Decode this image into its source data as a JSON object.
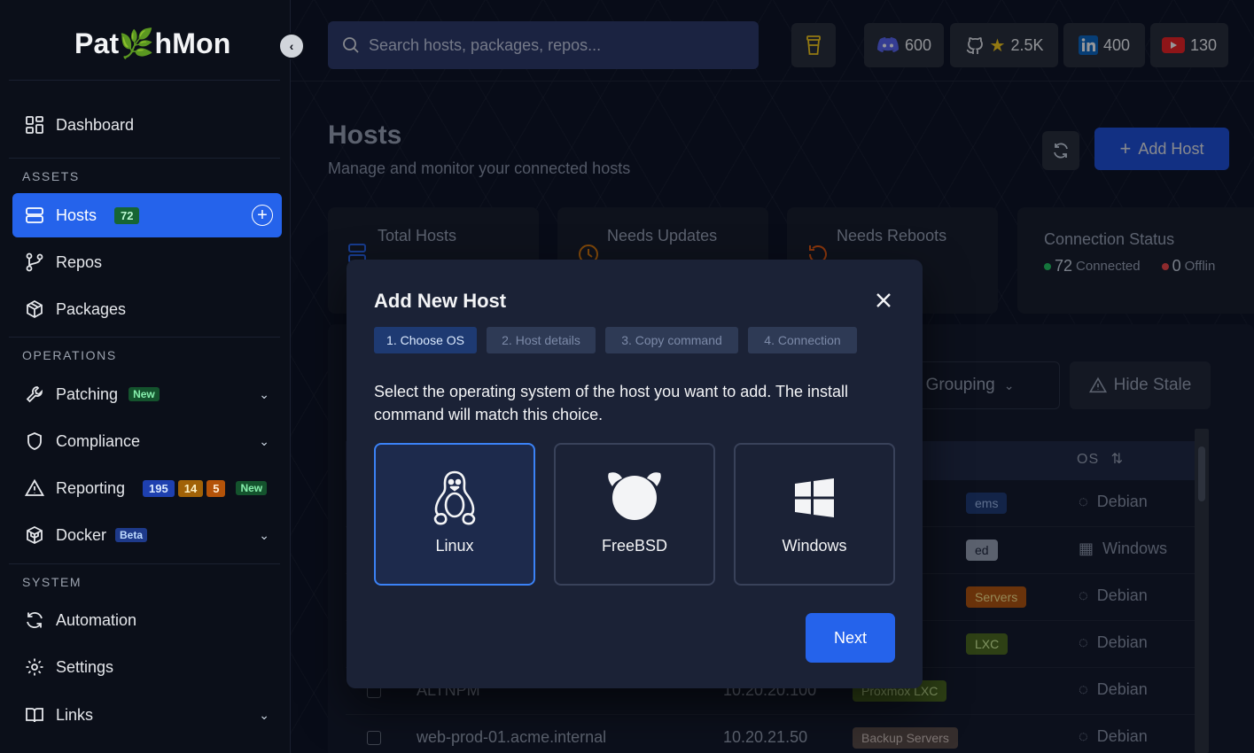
{
  "brand": {
    "logo_pre": "Pat",
    "logo_post": "hMon"
  },
  "sidebar": {
    "sections": {
      "assets": "ASSETS",
      "operations": "OPERATIONS",
      "system": "SYSTEM"
    },
    "items": {
      "dashboard": "Dashboard",
      "hosts": "Hosts",
      "hosts_count": "72",
      "repos": "Repos",
      "packages": "Packages",
      "patching": "Patching",
      "patching_badge": "New",
      "compliance": "Compliance",
      "reporting": "Reporting",
      "reporting_b1": "195",
      "reporting_b2": "14",
      "reporting_b3": "5",
      "reporting_badge": "New",
      "docker": "Docker",
      "docker_badge": "Beta",
      "automation": "Automation",
      "settings": "Settings",
      "links": "Links"
    }
  },
  "topbar": {
    "search_placeholder": "Search hosts, packages, repos...",
    "discord_count": "600",
    "github_stars": "2.5K",
    "linkedin_count": "400",
    "youtube_count": "130"
  },
  "page": {
    "title": "Hosts",
    "subtitle": "Manage and monitor your connected hosts",
    "add_host": "Add Host",
    "stats": {
      "total_hosts": "Total Hosts",
      "needs_updates": "Needs Updates",
      "needs_reboots": "Needs Reboots",
      "connection_status": "Connection Status",
      "connected_count": "72",
      "connected_label": "Connected",
      "offline_count": "0",
      "offline_label": "Offlin"
    },
    "grouping": "No Grouping",
    "hide_stale": "Hide Stale",
    "os_header": "OS",
    "rows": [
      {
        "name": "",
        "ip": "",
        "group": "ems",
        "os": "Debian"
      },
      {
        "name": "",
        "ip": "",
        "group": "ed",
        "os": "Windows"
      },
      {
        "name": "",
        "ip": "",
        "group": "Servers",
        "os": "Debian"
      },
      {
        "name": "",
        "ip": "",
        "group": "LXC",
        "os": "Debian"
      },
      {
        "name": "ALTNPM",
        "ip": "10.20.20.100",
        "group": "Proxmox LXC",
        "os": "Debian"
      },
      {
        "name": "web-prod-01.acme.internal",
        "ip": "10.20.21.50",
        "group": "Backup Servers",
        "os": "Debian"
      }
    ]
  },
  "modal": {
    "title": "Add New Host",
    "steps": [
      "1. Choose OS",
      "2. Host details",
      "3. Copy command",
      "4. Connection"
    ],
    "active_step": 0,
    "description": "Select the operating system of the host you want to add. The install command will match this choice.",
    "os_options": [
      "Linux",
      "FreeBSD",
      "Windows"
    ],
    "selected_os": "Linux",
    "next": "Next"
  },
  "colors": {
    "accent": "#2563eb",
    "background": "#0a0d16",
    "modal": "#1b2236"
  }
}
